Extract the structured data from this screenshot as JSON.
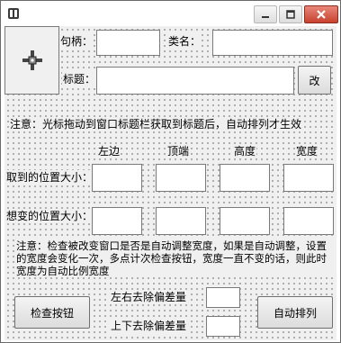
{
  "window": {
    "min_glyph": "—",
    "max_glyph": "▢",
    "close_glyph": "✕"
  },
  "labels": {
    "handle": "句柄：",
    "classname": "类名：",
    "title": "标题：",
    "change_button": "改",
    "hint1": "注意：光标拖动到窗口标题栏获取到标题后，自动排列才生效",
    "col_left": "左边",
    "col_top": "顶端",
    "col_height": "高度",
    "col_width": "宽度",
    "row_obtained": "取到的位置大小：",
    "row_desired": "想变的位置大小：",
    "hint2": "注意：检查被改变窗口是否是自动调整宽度，如果是自动调整，设置的宽度会变化一次，多点计次检查按钮，宽度一直不变的话，则此时宽度为自动比例宽度",
    "check_button": "检查按钮",
    "lr_offset": "左右去除偏差量",
    "tb_offset": "上下去除偏差量",
    "auto_button": "自动排列"
  },
  "fields": {
    "handle": "",
    "classname": "",
    "title": "",
    "obtained_left": "",
    "obtained_top": "",
    "obtained_height": "",
    "obtained_width": "",
    "desired_left": "",
    "desired_top": "",
    "desired_height": "",
    "desired_width": "",
    "lr_offset": "",
    "tb_offset": ""
  }
}
